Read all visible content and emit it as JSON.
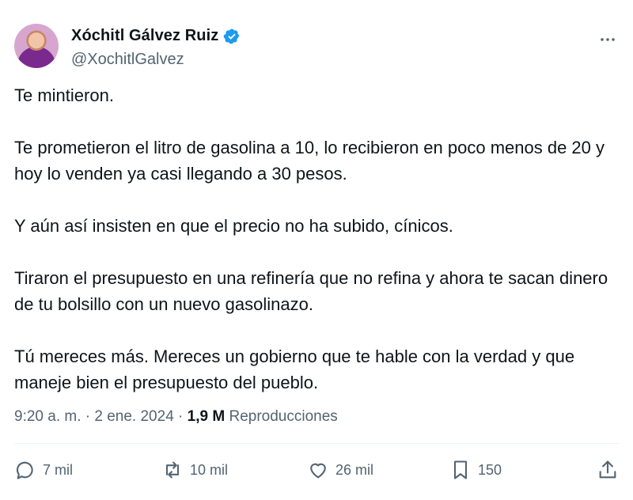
{
  "author": {
    "display_name": "Xóchitl Gálvez Ruiz",
    "handle": "@XochitlGalvez",
    "verified": true
  },
  "tweet": {
    "text": "Te mintieron.\n\nTe prometieron el litro de gasolina a 10, lo recibieron en poco menos de 20 y hoy lo venden ya casi llegando a 30 pesos.\n\nY aún así insisten en que el precio no ha subido, cínicos.\n\nTiraron el presupuesto en una refinería que no refina y ahora te sacan dinero de tu bolsillo con un nuevo gasolinazo.\n\nTú mereces más. Mereces un gobierno que te hable con la verdad y que maneje bien el presupuesto del pueblo."
  },
  "meta": {
    "time": "9:20 a. m.",
    "separator": "·",
    "date": "2 ene. 2024",
    "views_count": "1,9 M",
    "views_label": "Reproducciones"
  },
  "actions": {
    "replies": "7 mil",
    "reposts": "10 mil",
    "likes": "26 mil",
    "bookmarks": "150"
  },
  "icons": {
    "more": "more-icon",
    "reply": "reply-icon",
    "repost": "repost-icon",
    "like": "heart-icon",
    "bookmark": "bookmark-icon",
    "share": "share-icon",
    "verified": "verified-badge-icon"
  },
  "colors": {
    "text": "#0f1419",
    "secondary": "#536471",
    "verified": "#1d9bf0",
    "divider": "#eff3f4"
  }
}
